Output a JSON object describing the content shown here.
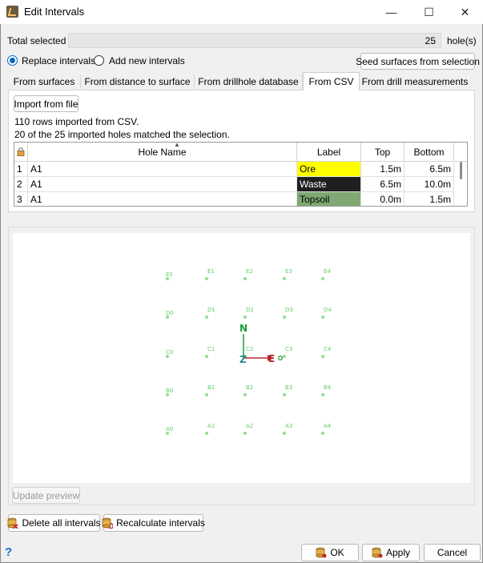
{
  "window": {
    "title": "Edit Intervals",
    "minimize": "—",
    "maximize": "☐",
    "close": "✕"
  },
  "total": {
    "label": "Total selected",
    "value": "25",
    "unit": "hole(s)"
  },
  "mode": {
    "replace": "Replace intervals",
    "add": "Add new intervals",
    "selected": "replace"
  },
  "seed_button": "Seed surfaces from selection",
  "tabs": [
    {
      "label": "From surfaces"
    },
    {
      "label": "From distance to surface"
    },
    {
      "label": "From drillhole database"
    },
    {
      "label": "From CSV"
    },
    {
      "label": "From drill measurements"
    }
  ],
  "active_tab": "From CSV",
  "csv": {
    "import_button": "Import from file",
    "rows_info": "110 rows imported from CSV.",
    "match_info": "20 of the 25 imported holes matched the selection."
  },
  "table": {
    "columns": [
      "Hole Name",
      "Label",
      "Top",
      "Bottom"
    ],
    "rows": [
      {
        "index": "1",
        "hole": "A1",
        "label": "Ore",
        "label_bg": "#ffff00",
        "label_fg": "#000000",
        "top": "1.5m",
        "bottom": "6.5m"
      },
      {
        "index": "2",
        "hole": "A1",
        "label": "Waste",
        "label_bg": "#1f1f1f",
        "label_fg": "#ffffff",
        "top": "6.5m",
        "bottom": "10.0m"
      },
      {
        "index": "3",
        "hole": "A1",
        "label": "Topsoil",
        "label_bg": "#7fa873",
        "label_fg": "#000000",
        "top": "0.0m",
        "bottom": "1.5m"
      }
    ]
  },
  "preview": {
    "holes": [
      "E0",
      "E1",
      "E2",
      "E3",
      "E4",
      "D0",
      "D1",
      "D2",
      "D3",
      "D4",
      "C0",
      "C1",
      "C2",
      "C3",
      "C4",
      "B0",
      "B1",
      "B2",
      "B3",
      "B4",
      "A0",
      "A1",
      "A2",
      "A3",
      "A4"
    ],
    "axis": {
      "north": "N",
      "east": "E",
      "z": "Z"
    },
    "point_color": "#8fdf8f"
  },
  "update_preview": "Update preview",
  "delete_button": "Delete all intervals",
  "recalc_button": "Recalculate intervals",
  "help_icon": "?",
  "ok_button": "OK",
  "apply_button": "Apply",
  "cancel_button": "Cancel"
}
